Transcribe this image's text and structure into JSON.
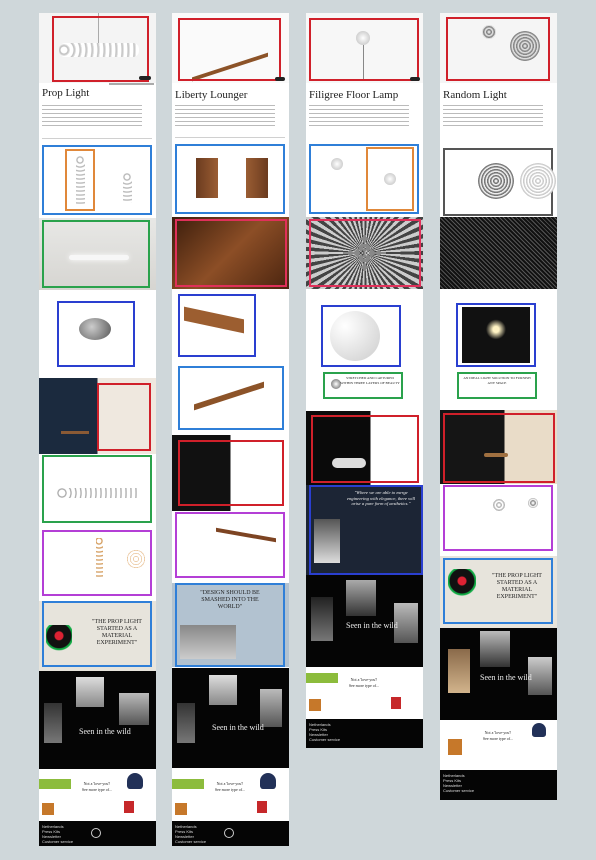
{
  "colors": {
    "red": "#d0202a",
    "blue": "#2f7fd8",
    "green": "#2aa24c",
    "purple": "#b43fd6",
    "orange": "#e0883a",
    "dark_blue": "#2a3fd0",
    "grey": "#555555",
    "pink": "#e0305a"
  },
  "columns": [
    {
      "title": "Prop Light",
      "quote": "\"THE PROP LIGHT STARTED AS A MATERIAL EXPERIMENT\"",
      "wild": "Seen in the wild",
      "footer": [
        "Netherlands",
        "Press Kits",
        "Newsletter",
        "Customer service"
      ],
      "newsletter": [
        "Not a 'love-you'!",
        "See more type of..."
      ]
    },
    {
      "title": "Liberty Lounger",
      "quote": "\"DESIGN SHOULD BE SMASHED INTO THE WORLD\"",
      "wild": "Seen in the wild",
      "footer": [
        "Netherlands",
        "Press Kits",
        "Newsletter",
        "Customer service"
      ],
      "newsletter": [
        "Not a 'love-you'!",
        "See more type of..."
      ]
    },
    {
      "title": "Filigree Floor Lamp",
      "badge": "STRETCHED AND CAPTURED WITHIN THREE LAYERS OF BEAUTY",
      "quote": "\"Where we are able to merge engineering with elegance, there will arise a pure form of aesthetics.\"",
      "wild": "Seen in the wild",
      "footer": [
        "Netherlands",
        "Press Kits",
        "Newsletter",
        "Customer service"
      ],
      "newsletter": [
        "Not a 'love-you'!",
        "See more type of..."
      ]
    },
    {
      "title": "Random Light",
      "badge": "AN IDEAL LIGHT SOLUTION TO FURNISH ANY SPACE",
      "quote": "\"THE PROP LIGHT STARTED AS A MATERIAL EXPERIMENT\"",
      "wild": "Seen in the wild",
      "footer": [
        "Netherlands",
        "Press Kits",
        "Newsletter",
        "Customer service"
      ],
      "newsletter": [
        "Not a 'love-you'!",
        "See more type of..."
      ]
    }
  ]
}
